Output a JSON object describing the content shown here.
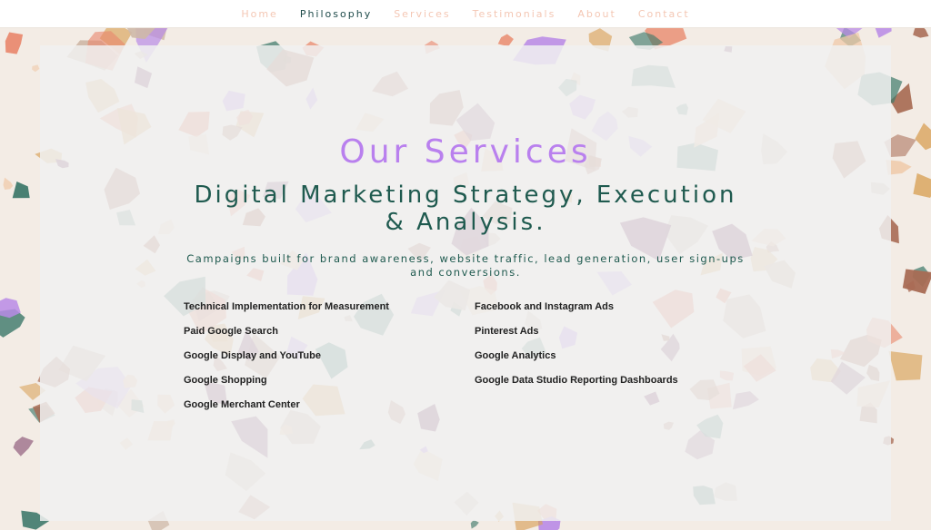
{
  "nav": {
    "items": [
      {
        "label": "Home",
        "active": false
      },
      {
        "label": "Philosophy",
        "active": true
      },
      {
        "label": "Services",
        "active": false
      },
      {
        "label": "Testimonials",
        "active": false
      },
      {
        "label": "About",
        "active": false
      },
      {
        "label": "Contact",
        "active": false
      }
    ]
  },
  "page": {
    "title": "Our Services",
    "subtitle": "Digital Marketing Strategy, Execution & Analysis.",
    "tagline": "Campaigns built for brand awareness, website traffic, lead generation, user sign-ups and conversions."
  },
  "services": {
    "left": [
      "Technical Implementation for Measurement",
      "Paid Google Search",
      "Google Display and YouTube",
      "Google Shopping",
      "Google Merchant Center"
    ],
    "right": [
      "Facebook and Instagram Ads",
      "Pinterest Ads",
      "Google Analytics",
      "Google Data Studio Reporting Dashboards"
    ]
  },
  "colors": {
    "nav_active": "#1f4b4a",
    "nav_inactive": "#f4c7b4",
    "title": "#b980ee",
    "heading": "#1f5a4f",
    "body_text": "#222222",
    "terrazzo": [
      "#3f7a6b",
      "#7a3b64",
      "#b98be6",
      "#d9a25a",
      "#e9866a",
      "#a86b54",
      "#f0c9a8",
      "#cfb9a8"
    ]
  }
}
